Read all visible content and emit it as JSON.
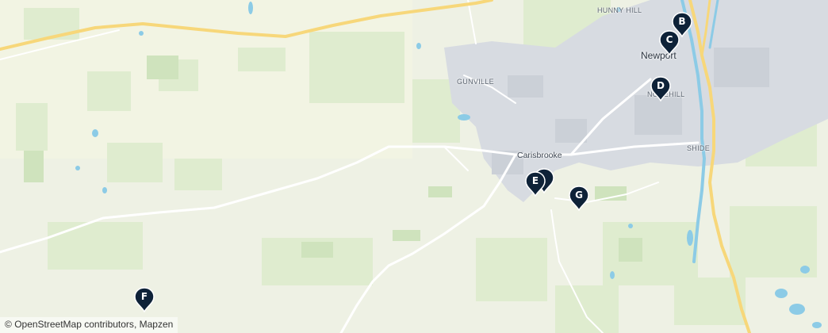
{
  "places": {
    "hunny_hill": "HUNNY HILL",
    "newport": "Newport",
    "gunville": "GUNVILLE",
    "nodehill": "NODEHILL",
    "carisbrooke": "Carisbrooke",
    "shide": "SHIDE"
  },
  "markers": {
    "b": "B",
    "c": "C",
    "d": "D",
    "e": "E",
    "f": "F",
    "g": "G"
  },
  "attribution": {
    "symbol": "©",
    "osm": "OpenStreetMap contributors",
    "separator": ",",
    "mapzen": "Mapzen"
  },
  "colors": {
    "land": "#eef1e4",
    "field": "#dfeccf",
    "urban": "#d7dbe1",
    "water": "#8ccbe6",
    "road": "#f7d77a",
    "marker": "#0e2238"
  }
}
